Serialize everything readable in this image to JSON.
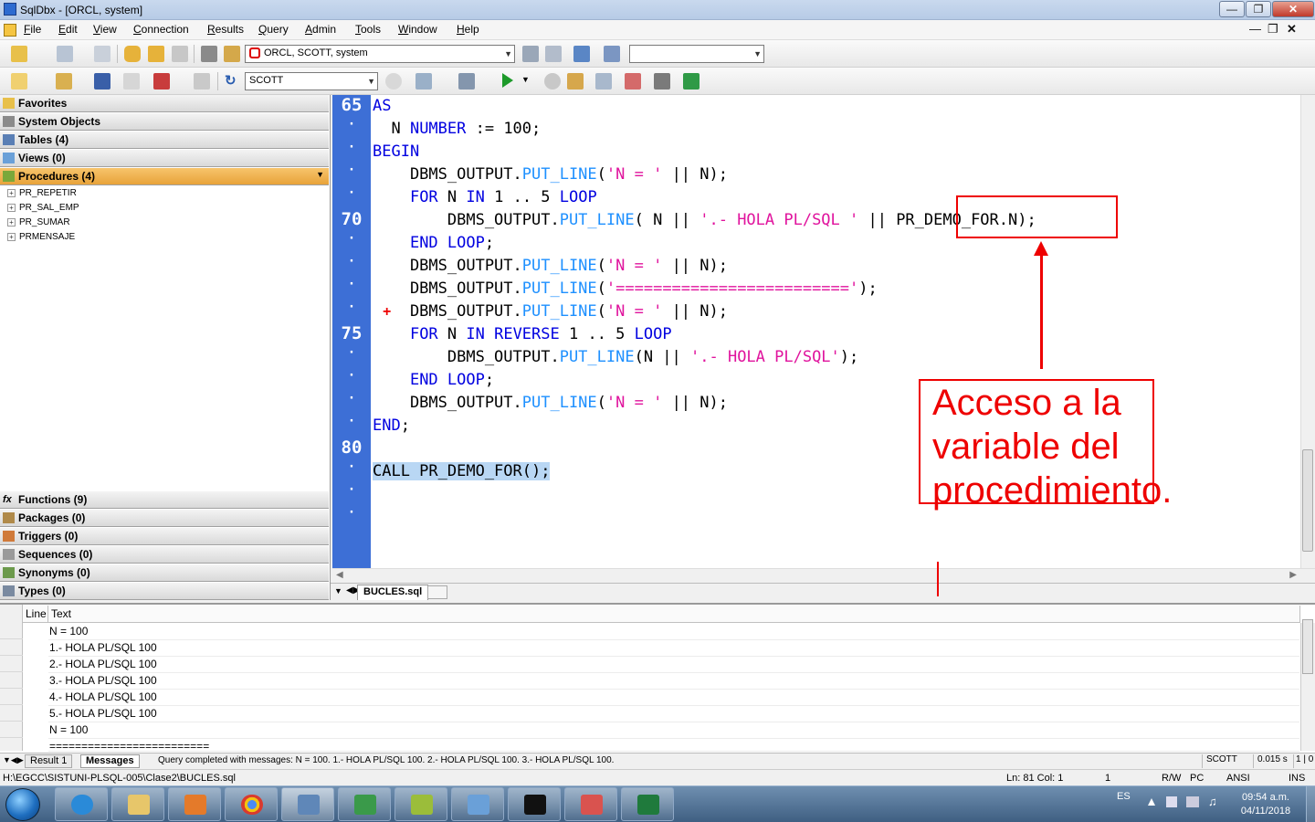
{
  "window": {
    "title": "SqlDbx - [ORCL, system]"
  },
  "menu": [
    "File",
    "Edit",
    "View",
    "Connection",
    "Results",
    "Query",
    "Admin",
    "Tools",
    "Window",
    "Help"
  ],
  "toolbar": {
    "connection": "ORCL, SCOTT, system",
    "schema": "SCOTT",
    "blank_combo": ""
  },
  "left_panel": {
    "sections_top": [
      "Favorites",
      "System Objects",
      "Tables  (4)",
      "Views  (0)"
    ],
    "active_section": "Procedures  (4)",
    "procedures": [
      "PR_REPETIR",
      "PR_SAL_EMP",
      "PR_SUMAR",
      "PRMENSAJE"
    ],
    "sections_bottom": [
      "Functions  (9)",
      "Packages  (0)",
      "Triggers  (0)",
      "Sequences  (0)",
      "Synonyms  (0)",
      "Types  (0)"
    ]
  },
  "editor": {
    "line_numbers": [
      "65",
      "70",
      "75",
      "80"
    ],
    "code": {
      "l1_kw": "AS",
      "l2_a": "  N ",
      "l2_kw": "NUMBER",
      "l2_b": " := 100;",
      "l3_kw": "BEGIN",
      "l4_a": "    DBMS_OUTPUT.",
      "l4_fn": "PUT_LINE",
      "l4_b": "(",
      "l4_st": "'N = '",
      "l4_c": " || N);",
      "l5_a": "    ",
      "l5_kw1": "FOR",
      "l5_b": " N ",
      "l5_kw2": "IN",
      "l5_c": " 1 .. 5 ",
      "l5_kw3": "LOOP",
      "l6_a": "        DBMS_OUTPUT.",
      "l6_fn": "PUT_LINE",
      "l6_b": "( N || ",
      "l6_st": "'.- HOLA PL/SQL '",
      "l6_c": " || PR_DEMO_FOR.N);",
      "l7_a": "    ",
      "l7_kw": "END LOOP",
      "l7_b": ";",
      "l8_a": "    DBMS_OUTPUT.",
      "l8_fn": "PUT_LINE",
      "l8_b": "(",
      "l8_st": "'N = '",
      "l8_c": " || N);",
      "l9_a": "    DBMS_OUTPUT.",
      "l9_fn": "PUT_LINE",
      "l9_b": "(",
      "l9_st": "'========================='",
      "l9_c": ");",
      "l10_a": "    DBMS_OUTPUT.",
      "l10_fn": "PUT_LINE",
      "l10_b": "(",
      "l10_st": "'N = '",
      "l10_c": " || N);",
      "l11_a": "    ",
      "l11_kw1": "FOR",
      "l11_b": " N ",
      "l11_kw2": "IN REVERSE",
      "l11_c": " 1 .. 5 ",
      "l11_kw3": "LOOP",
      "l12_a": "        DBMS_OUTPUT.",
      "l12_fn": "PUT_LINE",
      "l12_b": "(N || ",
      "l12_st": "'.- HOLA PL/SQL'",
      "l12_c": ");",
      "l13_a": "    ",
      "l13_kw": "END LOOP",
      "l13_b": ";",
      "l14_a": "    DBMS_OUTPUT.",
      "l14_fn": "PUT_LINE",
      "l14_b": "(",
      "l14_st": "'N = '",
      "l14_c": " || N);",
      "l15_kw": "END",
      "l15_b": ";",
      "l17": "CALL PR_DEMO_FOR();"
    },
    "modified_marker": "+",
    "tab": "BUCLES.sql"
  },
  "annotation": {
    "text": "Acceso a la variable del procedimiento.",
    "color": "#e00000"
  },
  "results": {
    "columns": [
      "Line",
      "Text"
    ],
    "rows": [
      "N = 100",
      "1.- HOLA PL/SQL 100",
      "2.- HOLA PL/SQL 100",
      "3.- HOLA PL/SQL 100",
      "4.- HOLA PL/SQL 100",
      "5.- HOLA PL/SQL 100",
      "N = 100",
      "========================="
    ],
    "tabs": [
      "Result 1",
      "Messages"
    ],
    "message": "Query completed with messages: N = 100. 1.- HOLA PL/SQL 100. 2.- HOLA PL/SQL 100. 3.- HOLA PL/SQL 100.",
    "user": "SCOTT",
    "time": "0.015 s",
    "count": "1 | 0"
  },
  "statusbar": {
    "path": "H:\\EGCC\\SISTUNI-PLSQL-005\\Clase2\\BUCLES.sql",
    "position": "Ln: 81  Col: 1",
    "num": "1",
    "mode": "R/W",
    "pc": "PC",
    "encoding": "ANSI",
    "ins": "INS"
  },
  "taskbar": {
    "lang": "ES",
    "time": "09:54 a.m.",
    "date": "04/11/2018"
  }
}
